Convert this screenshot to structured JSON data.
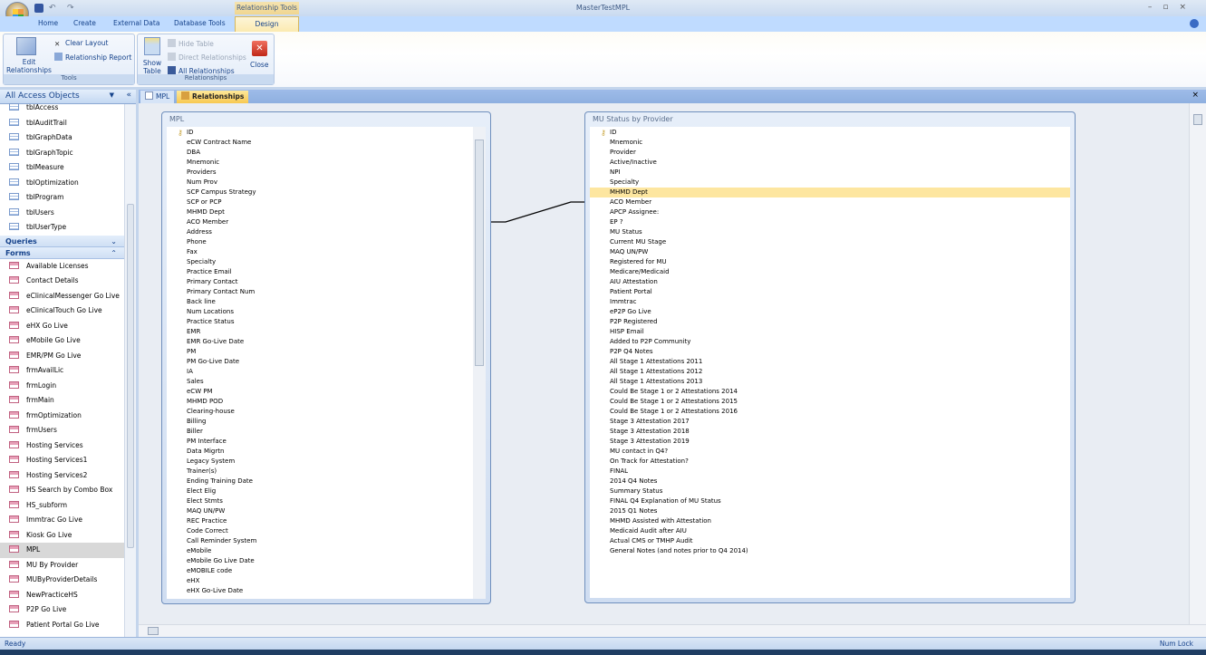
{
  "window": {
    "title": "MasterTestMPL",
    "context_tab_group": "Relationship Tools"
  },
  "ribbon_tabs": [
    "Home",
    "Create",
    "External Data",
    "Database Tools",
    "Design"
  ],
  "ribbon": {
    "tools": {
      "label": "Tools",
      "edit_relationships": "Edit Relationships",
      "clear_layout": "Clear Layout",
      "relationship_report": "Relationship Report"
    },
    "relationships": {
      "label": "Relationships",
      "show_table": "Show Table",
      "hide_table": "Hide Table",
      "direct_relationships": "Direct Relationships",
      "all_relationships": "All Relationships",
      "close": "Close"
    }
  },
  "nav": {
    "header": "All Access Objects",
    "tables": [
      "tblAccess",
      "tblAuditTrail",
      "tblGraphData",
      "tblGraphTopic",
      "tblMeasure",
      "tblOptimization",
      "tblProgram",
      "tblUsers",
      "tblUserType"
    ],
    "queries_label": "Queries",
    "forms_label": "Forms",
    "forms": [
      "Available Licenses",
      "Contact Details",
      "eClinicalMessenger Go Live",
      "eClinicalTouch Go Live",
      "eHX Go Live",
      "eMobile Go Live",
      "EMR/PM Go Live",
      "frmAvailLic",
      "frmLogin",
      "frmMain",
      "frmOptimization",
      "frmUsers",
      "Hosting Services",
      "Hosting Services1",
      "Hosting Services2",
      "HS Search by Combo Box",
      "HS_subform",
      "Immtrac Go Live",
      "Kiosk Go Live",
      "MPL",
      "MU By Provider",
      "MUByProviderDetails",
      "NewPracticeHS",
      "P2P Go Live",
      "Patient Portal Go Live"
    ],
    "selected": "MPL"
  },
  "doc_tabs": [
    "MPL",
    "Relationships"
  ],
  "tables": [
    {
      "title": "MPL",
      "fields": [
        "ID",
        "eCW Contract Name",
        "DBA",
        "Mnemonic",
        "Providers",
        "Num Prov",
        "SCP Campus Strategy",
        "SCP or PCP",
        "MHMD Dept",
        "ACO Member",
        "Address",
        "Phone",
        "Fax",
        "Specialty",
        "Practice Email",
        "Primary Contact",
        "Primary Contact Num",
        "Back line",
        "Num Locations",
        "Practice Status",
        "EMR",
        "EMR Go-Live Date",
        "PM",
        "PM Go-Live Date",
        "IA",
        "Sales",
        "eCW PM",
        "MHMD POD",
        "Clearing-house",
        "Billing",
        "Biller",
        "PM Interface",
        "Data Migrtn",
        "Legacy System",
        "Trainer(s)",
        "Ending Training Date",
        "Elect Elig",
        "Elect Stmts",
        "MAQ UN/PW",
        "REC Practice",
        "Code Correct",
        "Call Reminder System",
        "eMobile",
        "eMobile Go Live Date",
        "eMOBILE code",
        "eHX",
        "eHX Go-Live Date"
      ]
    },
    {
      "title": "MU Status by Provider",
      "highlighted": "MHMD Dept",
      "fields": [
        "ID",
        "Mnemonic",
        "Provider",
        "Active/Inactive",
        "NPI",
        "Specialty",
        "MHMD Dept",
        "ACO Member",
        "APCP Assignee:",
        "EP ?",
        "MU Status",
        "Current MU Stage",
        "MAQ UN/PW",
        "Registered for MU",
        "Medicare/Medicaid",
        "AIU Attestation",
        "Patient Portal",
        "Immtrac",
        "eP2P Go Live",
        "P2P Registered",
        "HISP Email",
        "Added to P2P Community",
        "P2P Q4 Notes",
        "All Stage 1 Attestations 2011",
        "All Stage 1 Attestations 2012",
        "All Stage 1 Attestations 2013",
        "Could Be Stage 1 or 2 Attestations 2014",
        "Could Be Stage 1 or 2 Attestations 2015",
        "Could Be Stage 1 or 2 Attestations 2016",
        "Stage 3 Attestation 2017",
        "Stage 3 Attestation 2018",
        "Stage 3 Attestation 2019",
        "MU contact in Q4?",
        "On Track for Attestation?",
        "FINAL",
        "2014 Q4 Notes",
        "Summary Status",
        "FINAL Q4 Explanation of MU Status",
        "2015 Q1 Notes",
        "MHMD Assisted with Attestation",
        "Medicaid Audit after AIU",
        "Actual CMS or TMHP Audit",
        "General Notes (and notes prior to Q4 2014)"
      ]
    }
  ],
  "status": {
    "left": "Ready",
    "right": "Num Lock"
  }
}
